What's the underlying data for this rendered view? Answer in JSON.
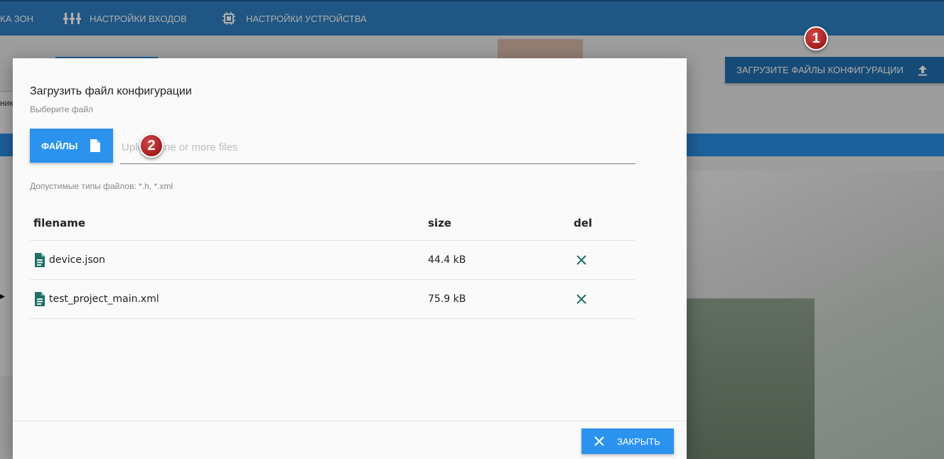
{
  "topnav": {
    "items": [
      {
        "label": "КА ЗОН",
        "icon": "zones-icon"
      },
      {
        "label": "НАСТРОЙКИ ВХОДОВ",
        "icon": "inputs-icon"
      },
      {
        "label": "НАСТРОЙКИ УСТРОЙСТВА",
        "icon": "chip-icon"
      }
    ]
  },
  "background": {
    "left_text": "ник",
    "upload_config_button": "ЗАГРУЗИТЕ ФАЙЛЫ КОНФИГУРАЦИИ"
  },
  "callouts": [
    "1",
    "2"
  ],
  "modal": {
    "title": "Загрузить файл конфигурации",
    "subtitle": "Выберите файл",
    "files_button": "ФАЙЛЫ",
    "file_input_placeholder": "Upload one or more files",
    "allowed_types": "Допустимые типы файлов: *.h, *.xml",
    "table": {
      "headers": {
        "filename": "filename",
        "size": "size",
        "del": "del"
      },
      "rows": [
        {
          "filename": "device.json",
          "size": "44.4 kB"
        },
        {
          "filename": "test_project_main.xml",
          "size": "75.9 kB"
        }
      ]
    },
    "close_button": "ЗАКРЫТЬ"
  },
  "colors": {
    "topbar": "#2f7fc1",
    "primary_button": "#2b93ee",
    "file_icon": "#1f6f66",
    "callout": "#a41d1d"
  }
}
